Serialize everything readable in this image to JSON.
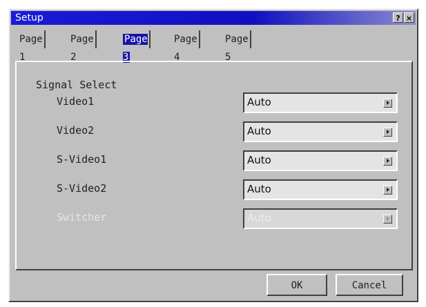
{
  "window": {
    "title": "Setup",
    "help_label": "?",
    "close_label": "×"
  },
  "tabs": [
    {
      "label": "Page 1",
      "active": false
    },
    {
      "label": "Page 2",
      "active": false
    },
    {
      "label": "Page 3",
      "active": true
    },
    {
      "label": "Page 4",
      "active": false
    },
    {
      "label": "Page 5",
      "active": false
    }
  ],
  "signal_select": {
    "section_label": "Signal Select",
    "rows": [
      {
        "label": "Video1",
        "value": "Auto",
        "enabled": true
      },
      {
        "label": "Video2",
        "value": "Auto",
        "enabled": true
      },
      {
        "label": "S-Video1",
        "value": "Auto",
        "enabled": true
      },
      {
        "label": "S-Video2",
        "value": "Auto",
        "enabled": true
      },
      {
        "label": "Switcher",
        "value": "Auto",
        "enabled": false
      }
    ]
  },
  "footer": {
    "ok_label": "OK",
    "cancel_label": "Cancel"
  },
  "colors": {
    "titlebar": "#1b1bd8",
    "dialog_face": "#c0c0c0",
    "active_tab_highlight": "#1515a8",
    "disabled_text": "#e6e6e6"
  }
}
